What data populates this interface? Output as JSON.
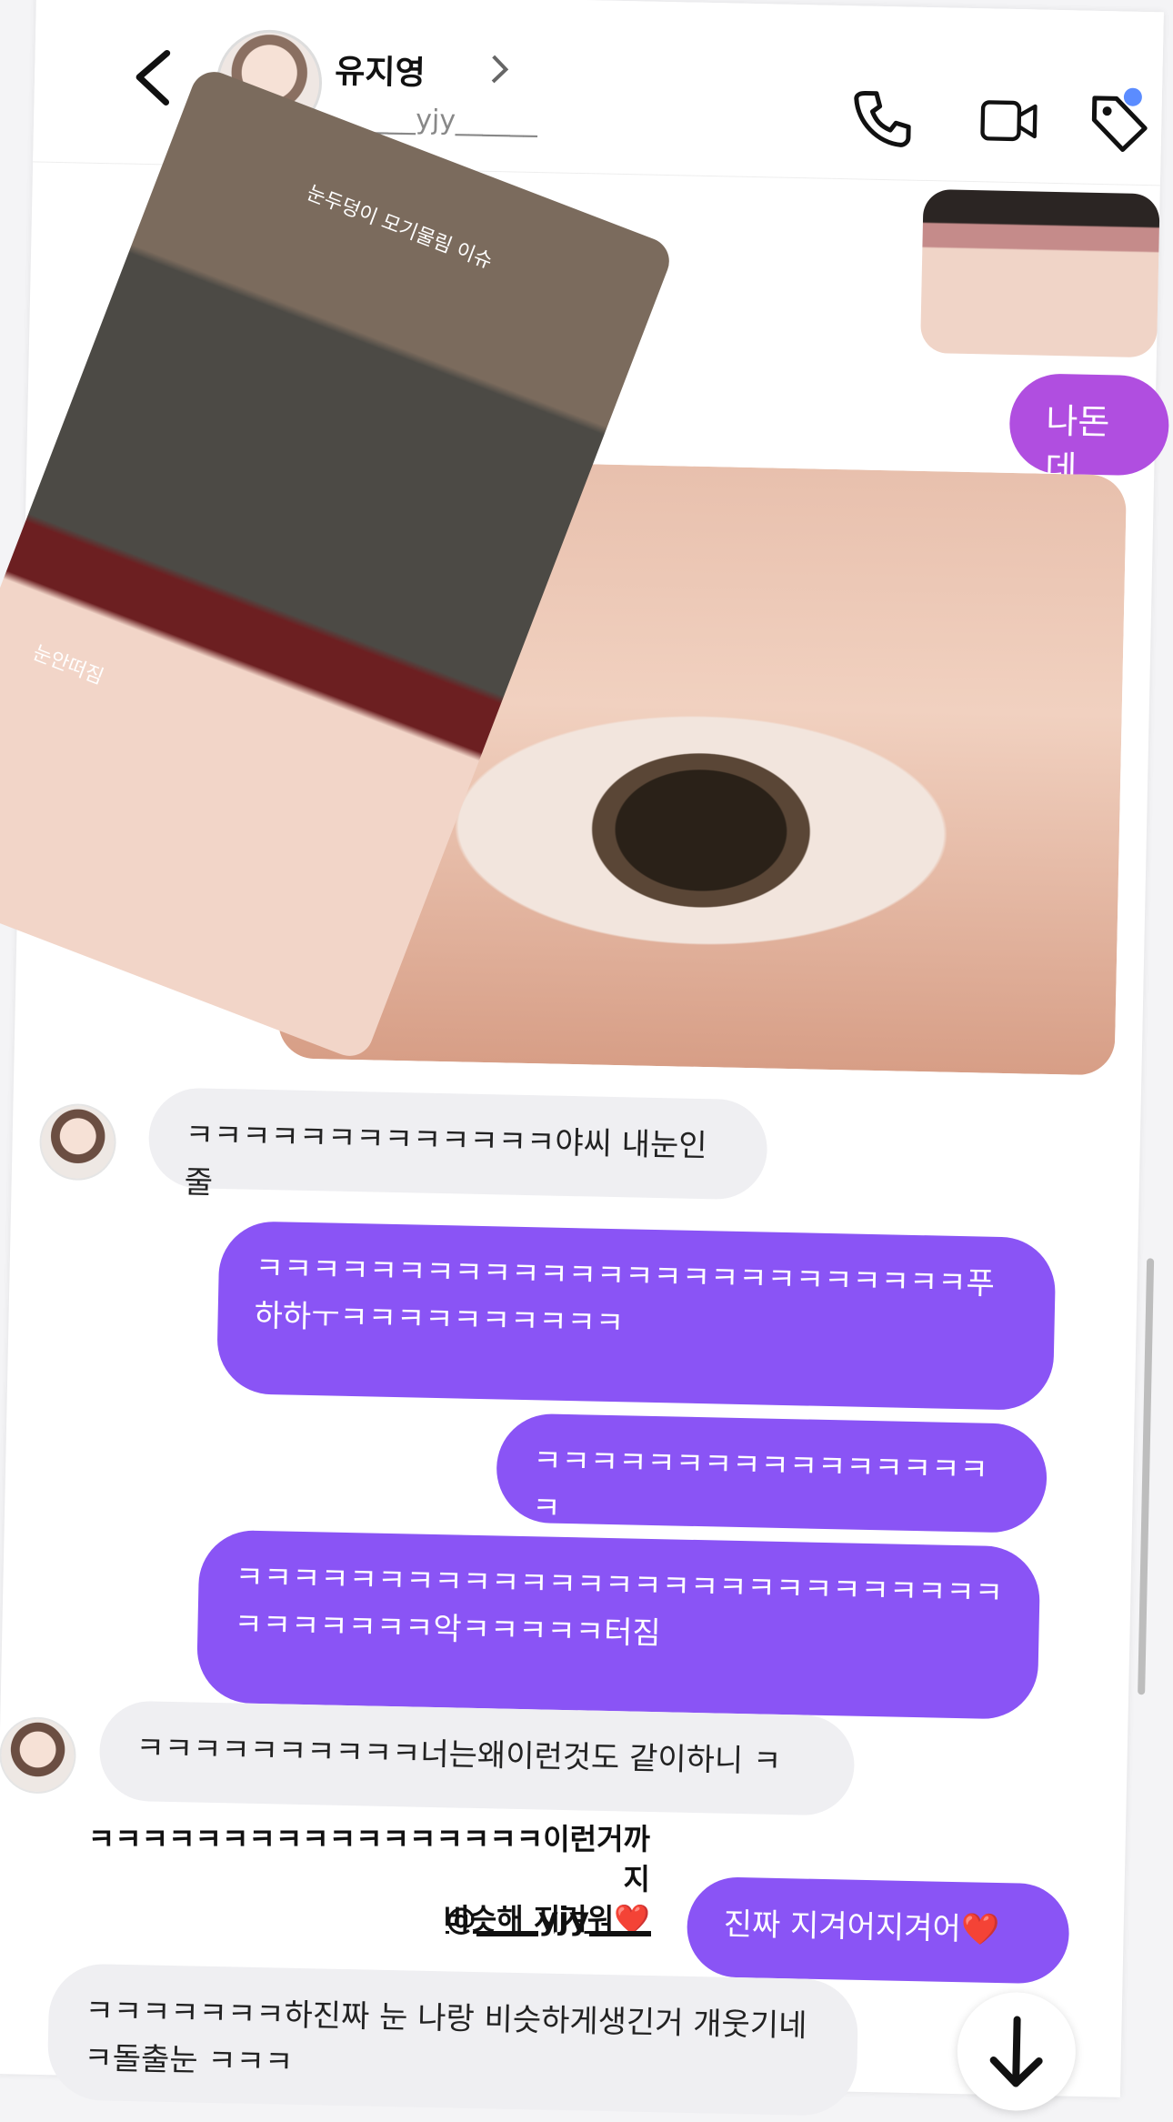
{
  "header": {
    "title": "유지영",
    "subtitle": "______yjy______",
    "icons": [
      "back-arrow-icon",
      "phone-icon",
      "video-icon",
      "tag-icon",
      "notification-dot"
    ]
  },
  "story": {
    "top_caption": "눈두덩이 모기물림 이슈",
    "inner_caption": "눈안떠짐"
  },
  "messages": [
    {
      "side": "out",
      "text": "나돈데"
    },
    {
      "side": "in",
      "text": "ㅋㅋㅋㅋㅋㅋㅋㅋㅋㅋㅋㅋㅋ야씨 내눈인줄"
    },
    {
      "side": "out",
      "text": "ㅋㅋㅋㅋㅋㅋㅋㅋㅋㅋㅋㅋㅋㅋㅋㅋㅋㅋㅋㅋㅋㅋㅋㅋㅋ푸하하ㅜㅋㅋㅋㅋㅋㅋㅋㅋㅋㅋ"
    },
    {
      "side": "out",
      "text": "ㅋㅋㅋㅋㅋㅋㅋㅋㅋㅋㅋㅋㅋㅋㅋㅋㅋ"
    },
    {
      "side": "out",
      "text": "ㅋㅋㅋㅋㅋㅋㅋㅋㅋㅋㅋㅋㅋㅋㅋㅋㅋㅋㅋㅋㅋㅋㅋㅋㅋㅋㅋㅋㅋㅋㅋㅋㅋㅋ악ㅋㅋㅋㅋㅋ터짐"
    },
    {
      "side": "in",
      "text": "ㅋㅋㅋㅋㅋㅋㅋㅋㅋㅋ너는왜이런것도 같이하니 ㅋ"
    },
    {
      "side": "out",
      "text": "진짜 지겨어지겨어❤️"
    },
    {
      "side": "in",
      "text": "ㅋㅋㅋㅋㅋㅋㅋ하진짜 눈 나랑 비슷하게생긴거 개웃기네 ㅋ돌출눈 ㅋㅋㅋ"
    }
  ],
  "sticker": {
    "line1": "ㅋㅋㅋㅋㅋㅋㅋㅋㅋㅋㅋㅋㅋㅋㅋㅋㅋ이런거까지",
    "line2": "비슷해 지겨워❤️",
    "handle": "@____yjy____"
  },
  "colors": {
    "accent": "#8a54f5",
    "pink": "#b04ee0",
    "bubble_in": "#efeff2"
  }
}
